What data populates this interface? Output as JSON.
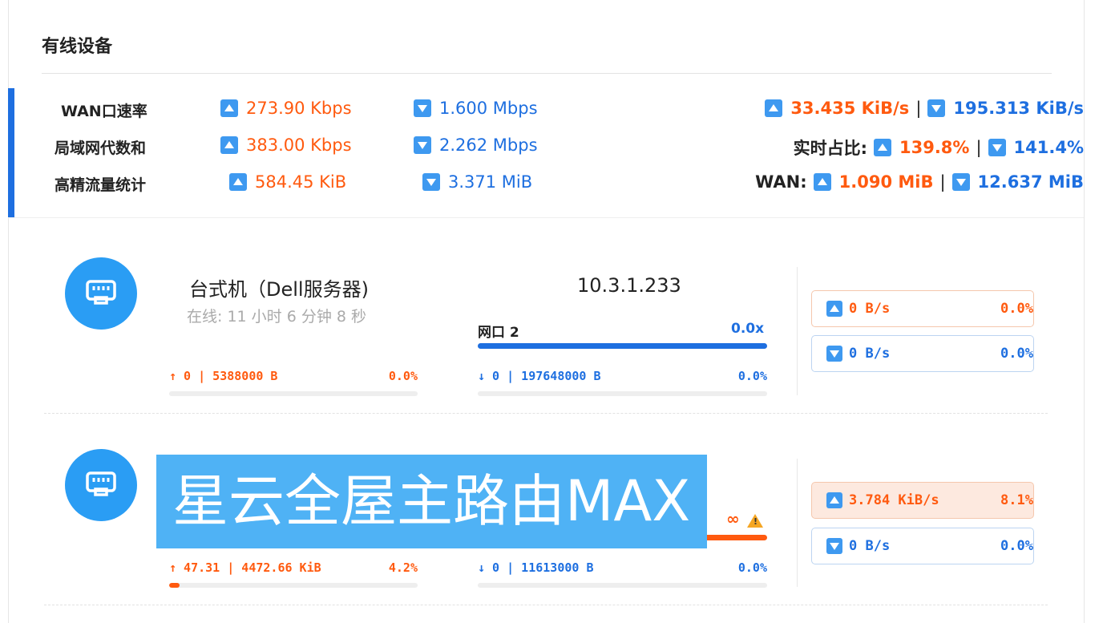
{
  "section_title": "有线设备",
  "stats": {
    "rows": [
      {
        "label": "WAN口速率",
        "up": "273.90 Kbps",
        "down": "1.600 Mbps"
      },
      {
        "label": "局域网代数和",
        "up": "383.00 Kbps",
        "down": "2.262 Mbps"
      },
      {
        "label": "高精流量统计",
        "up": "584.45 KiB",
        "down": "3.371 MiB"
      }
    ],
    "right": {
      "rate_up": "33.435 KiB/s",
      "rate_down": "195.313 KiB/s",
      "ratio_label": "实时占比:",
      "ratio_up": "139.8%",
      "ratio_down": "141.4%",
      "wan_label": "WAN:",
      "wan_up": "1.090 MiB",
      "wan_down": "12.637 MiB",
      "separator": "|"
    }
  },
  "devices": [
    {
      "name": "台式机（Dell服务器)",
      "online": "在线: 11 小时 6 分钟 8 秒",
      "ip": "10.3.1.233",
      "port": "网口 2",
      "port_rate": "0.0x",
      "port_bar_fraction": 1.0,
      "upload": "↑ 0 | 5388000 B",
      "upload_pct": "0.0%",
      "upload_fraction": 0.0,
      "download": "↓ 0 | 197648000 B",
      "download_pct": "0.0%",
      "download_fraction": 0.0,
      "box_up_value": "0 B/s",
      "box_up_pct": "0.0%",
      "box_down_value": "0 B/s",
      "box_down_pct": "0.0%"
    },
    {
      "name_overlay": "星云全屋主路由MAX",
      "port_rate": "∞",
      "upload": "↑ 47.31 | 4472.66 KiB",
      "upload_pct": "4.2%",
      "upload_fraction": 0.042,
      "download": "↓ 0 | 11613000 B",
      "download_pct": "0.0%",
      "download_fraction": 0.0,
      "box_up_value": "3.784 KiB/s",
      "box_up_pct": "8.1%",
      "box_down_value": "0 B/s",
      "box_down_pct": "0.0%"
    }
  ],
  "colors": {
    "accent_blue": "#1e6fe0",
    "accent_orange": "#ff5a0f",
    "avatar_blue": "#2a9df4"
  },
  "icons": [
    "up-triangle-icon",
    "down-triangle-icon",
    "ethernet-port-icon",
    "warning-icon"
  ]
}
